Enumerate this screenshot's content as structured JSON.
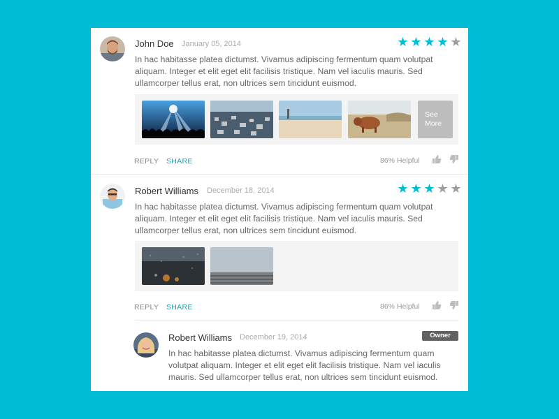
{
  "colors": {
    "background": "#00bcd4",
    "star_active": "#00bcd4",
    "star_inactive": "#9e9e9e",
    "share_link": "#1aa3bd",
    "owner_badge": "#616161"
  },
  "reviews": [
    {
      "author": "John Doe",
      "date": "January 05, 2014",
      "rating": 4,
      "max_rating": 5,
      "text": "In hac habitasse platea dictumst. Vivamus adipiscing fermentum quam volutpat aliquam. Integer et elit eget elit facilisis tristique. Nam vel iaculis mauris. Sed ullamcorper tellus erat, non ultrices sem tincidunt euismod.",
      "images": [
        "concert-crowd-photo",
        "city-aerial-photo",
        "beach-photo",
        "highland-cow-photo"
      ],
      "see_more": "See More",
      "reply_label": "REPLY",
      "share_label": "SHARE",
      "helpful": "86% Helpful"
    },
    {
      "author": "Robert Williams",
      "date": "December 18, 2014",
      "rating": 3,
      "max_rating": 5,
      "text": "In hac habitasse platea dictumst. Vivamus adipiscing fermentum quam volutpat aliquam. Integer et elit eget elit facilisis tristique. Nam vel iaculis mauris. Sed ullamcorper tellus erat, non ultrices sem tincidunt euismod.",
      "images": [
        "rainy-window-photo",
        "foggy-pier-photo"
      ],
      "reply_label": "REPLY",
      "share_label": "SHARE",
      "helpful": "86% Helpful",
      "reply": {
        "author": "Robert Williams",
        "date": "December 19, 2014",
        "badge": "Owner",
        "text": "In hac habitasse platea dictumst. Vivamus adipiscing fermentum quam volutpat aliquam. Integer et elit eget elit facilisis tristique. Nam vel iaculis mauris. Sed ullamcorper tellus erat, non ultrices sem tincidunt euismod."
      }
    }
  ],
  "icons": {
    "thumbs_up": "thumbs-up-icon",
    "thumbs_down": "thumbs-down-icon",
    "star": "star-icon"
  }
}
